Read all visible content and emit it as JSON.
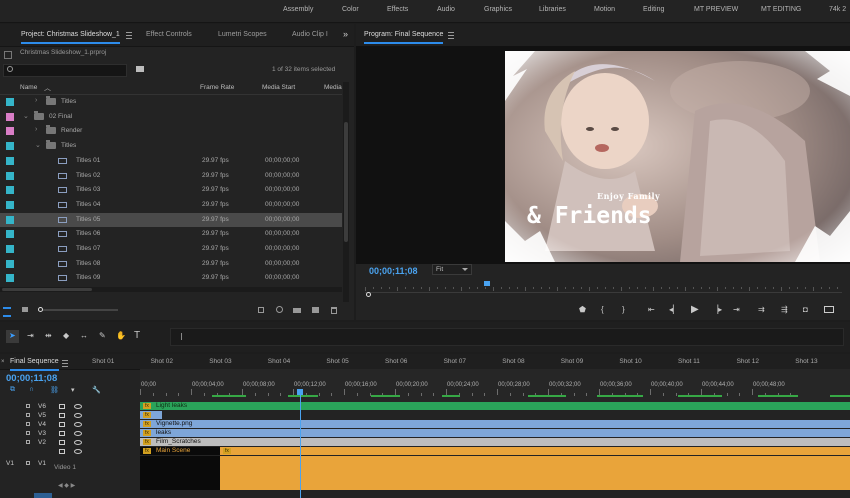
{
  "workspaces": [
    "Assembly",
    "Color",
    "Effects",
    "Audio",
    "Graphics",
    "Libraries",
    "Motion",
    "Editing",
    "MT PREVIEW",
    "MT EDITING",
    "74k 2"
  ],
  "project_panel": {
    "tabs": [
      "Project: Christmas Slideshow_1",
      "Effect Controls",
      "Lumetri Scopes",
      "Audio Clip I"
    ],
    "overflow": "»",
    "filename": "Christmas Slideshow_1.prproj",
    "selection_status": "1 of 32 items selected",
    "columns": [
      "Name",
      "Frame Rate",
      "Media Start",
      "Media"
    ],
    "rows": [
      {
        "name": "Titles",
        "rate": "",
        "start": "",
        "color": "#35b5c9",
        "kind": "folder",
        "depth": 2,
        "expanded": false
      },
      {
        "name": "02 Final",
        "rate": "",
        "start": "",
        "color": "#d97dc6",
        "kind": "folder",
        "depth": 1,
        "expanded": true
      },
      {
        "name": "Render",
        "rate": "",
        "start": "",
        "color": "#d97dc6",
        "kind": "folder",
        "depth": 2,
        "expanded": false
      },
      {
        "name": "Titles",
        "rate": "",
        "start": "",
        "color": "#35b5c9",
        "kind": "folder",
        "depth": 2,
        "expanded": true
      },
      {
        "name": "Titles 01",
        "rate": "29.97 fps",
        "start": "00;00;00;00",
        "color": "#35b5c9",
        "kind": "sequence",
        "depth": 3
      },
      {
        "name": "Titles 02",
        "rate": "29.97 fps",
        "start": "00;00;00;00",
        "color": "#35b5c9",
        "kind": "sequence",
        "depth": 3
      },
      {
        "name": "Titles 03",
        "rate": "29.97 fps",
        "start": "00;00;00;00",
        "color": "#35b5c9",
        "kind": "sequence",
        "depth": 3
      },
      {
        "name": "Titles 04",
        "rate": "29.97 fps",
        "start": "00;00;00;00",
        "color": "#35b5c9",
        "kind": "sequence",
        "depth": 3
      },
      {
        "name": "Titles 05",
        "rate": "29.97 fps",
        "start": "00;00;00;00",
        "color": "#35b5c9",
        "kind": "sequence",
        "depth": 3,
        "selected": true
      },
      {
        "name": "Titles 06",
        "rate": "29.97 fps",
        "start": "00;00;00;00",
        "color": "#35b5c9",
        "kind": "sequence",
        "depth": 3
      },
      {
        "name": "Titles 07",
        "rate": "29.97 fps",
        "start": "00;00;00;00",
        "color": "#35b5c9",
        "kind": "sequence",
        "depth": 3
      },
      {
        "name": "Titles 08",
        "rate": "29.97 fps",
        "start": "00;00;00;00",
        "color": "#35b5c9",
        "kind": "sequence",
        "depth": 3
      },
      {
        "name": "Titles 09",
        "rate": "29.97 fps",
        "start": "00;00;00;00",
        "color": "#35b5c9",
        "kind": "sequence",
        "depth": 3
      }
    ]
  },
  "program_monitor": {
    "title": "Program: Final Sequence",
    "timecode": "00;00;11;08",
    "zoom": "Fit",
    "overlay_small": "Enjoy Family",
    "overlay_big": "& Friends",
    "playhead_fraction": 0.25
  },
  "timeline": {
    "sequence_tab": "Final Sequence",
    "timecode": "00;00;11;08",
    "shots": [
      "Shot 01",
      "Shot 02",
      "Shot 03",
      "Shot 04",
      "Shot 05",
      "Shot 06",
      "Shot 07",
      "Shot 08",
      "Shot 09",
      "Shot 10",
      "Shot 11",
      "Shot 12",
      "Shot 13"
    ],
    "ruler": [
      "00;00",
      "00;00;04;00",
      "00;00;08;00",
      "00;00;12;00",
      "00;00;16;00",
      "00;00;20;00",
      "00;00;24;00",
      "00;00;28;00",
      "00;00;32;00",
      "00;00;36;00",
      "00;00;40;00",
      "00;00;44;00",
      "00;00;48;00"
    ],
    "video_tracks": [
      "V6",
      "V5",
      "V4",
      "V3",
      "V2",
      "V1"
    ],
    "source_patch": "V1",
    "video1_label": "Video 1",
    "clips": {
      "light_leaks": "Light leaks",
      "vignette": "Vignette.png",
      "leaks": "leaks",
      "film_scratches": "Film_Scratches",
      "main_scene": "Main Scene"
    },
    "fx_label": "fx"
  },
  "colors": {
    "accent": "#2d8ceb",
    "timecode": "#4aa3f0",
    "clip_blue": "#7ea6d8",
    "clip_gray": "#bdbdbd",
    "clip_orange": "#e9a43a",
    "clip_green": "#2aa35a"
  }
}
